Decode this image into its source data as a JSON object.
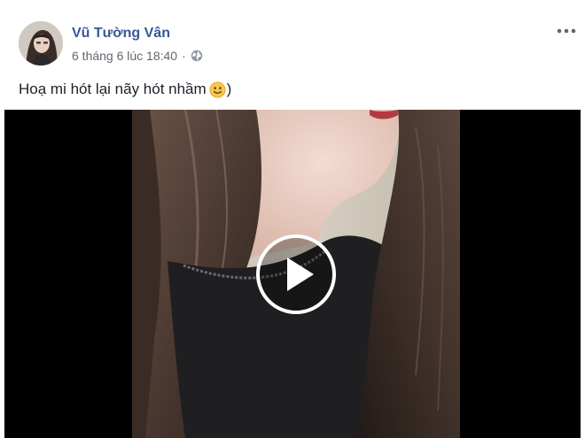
{
  "post": {
    "author": "Vũ Tường Vân",
    "timestamp": "6 tháng 6 lúc 18:40",
    "separator": "·",
    "privacy_icon": "globe-icon",
    "more_icon": "more-horizontal-icon",
    "caption_before": "Hoạ mi hót lại nãy hót nhầm",
    "caption_emoji": "slightly-smiling-face-emoji",
    "caption_after": ")"
  },
  "video": {
    "play_icon": "play-icon"
  },
  "colors": {
    "author_link": "#385898",
    "meta_text": "#616770",
    "caption_text": "#1d2129",
    "video_background": "#000000"
  }
}
